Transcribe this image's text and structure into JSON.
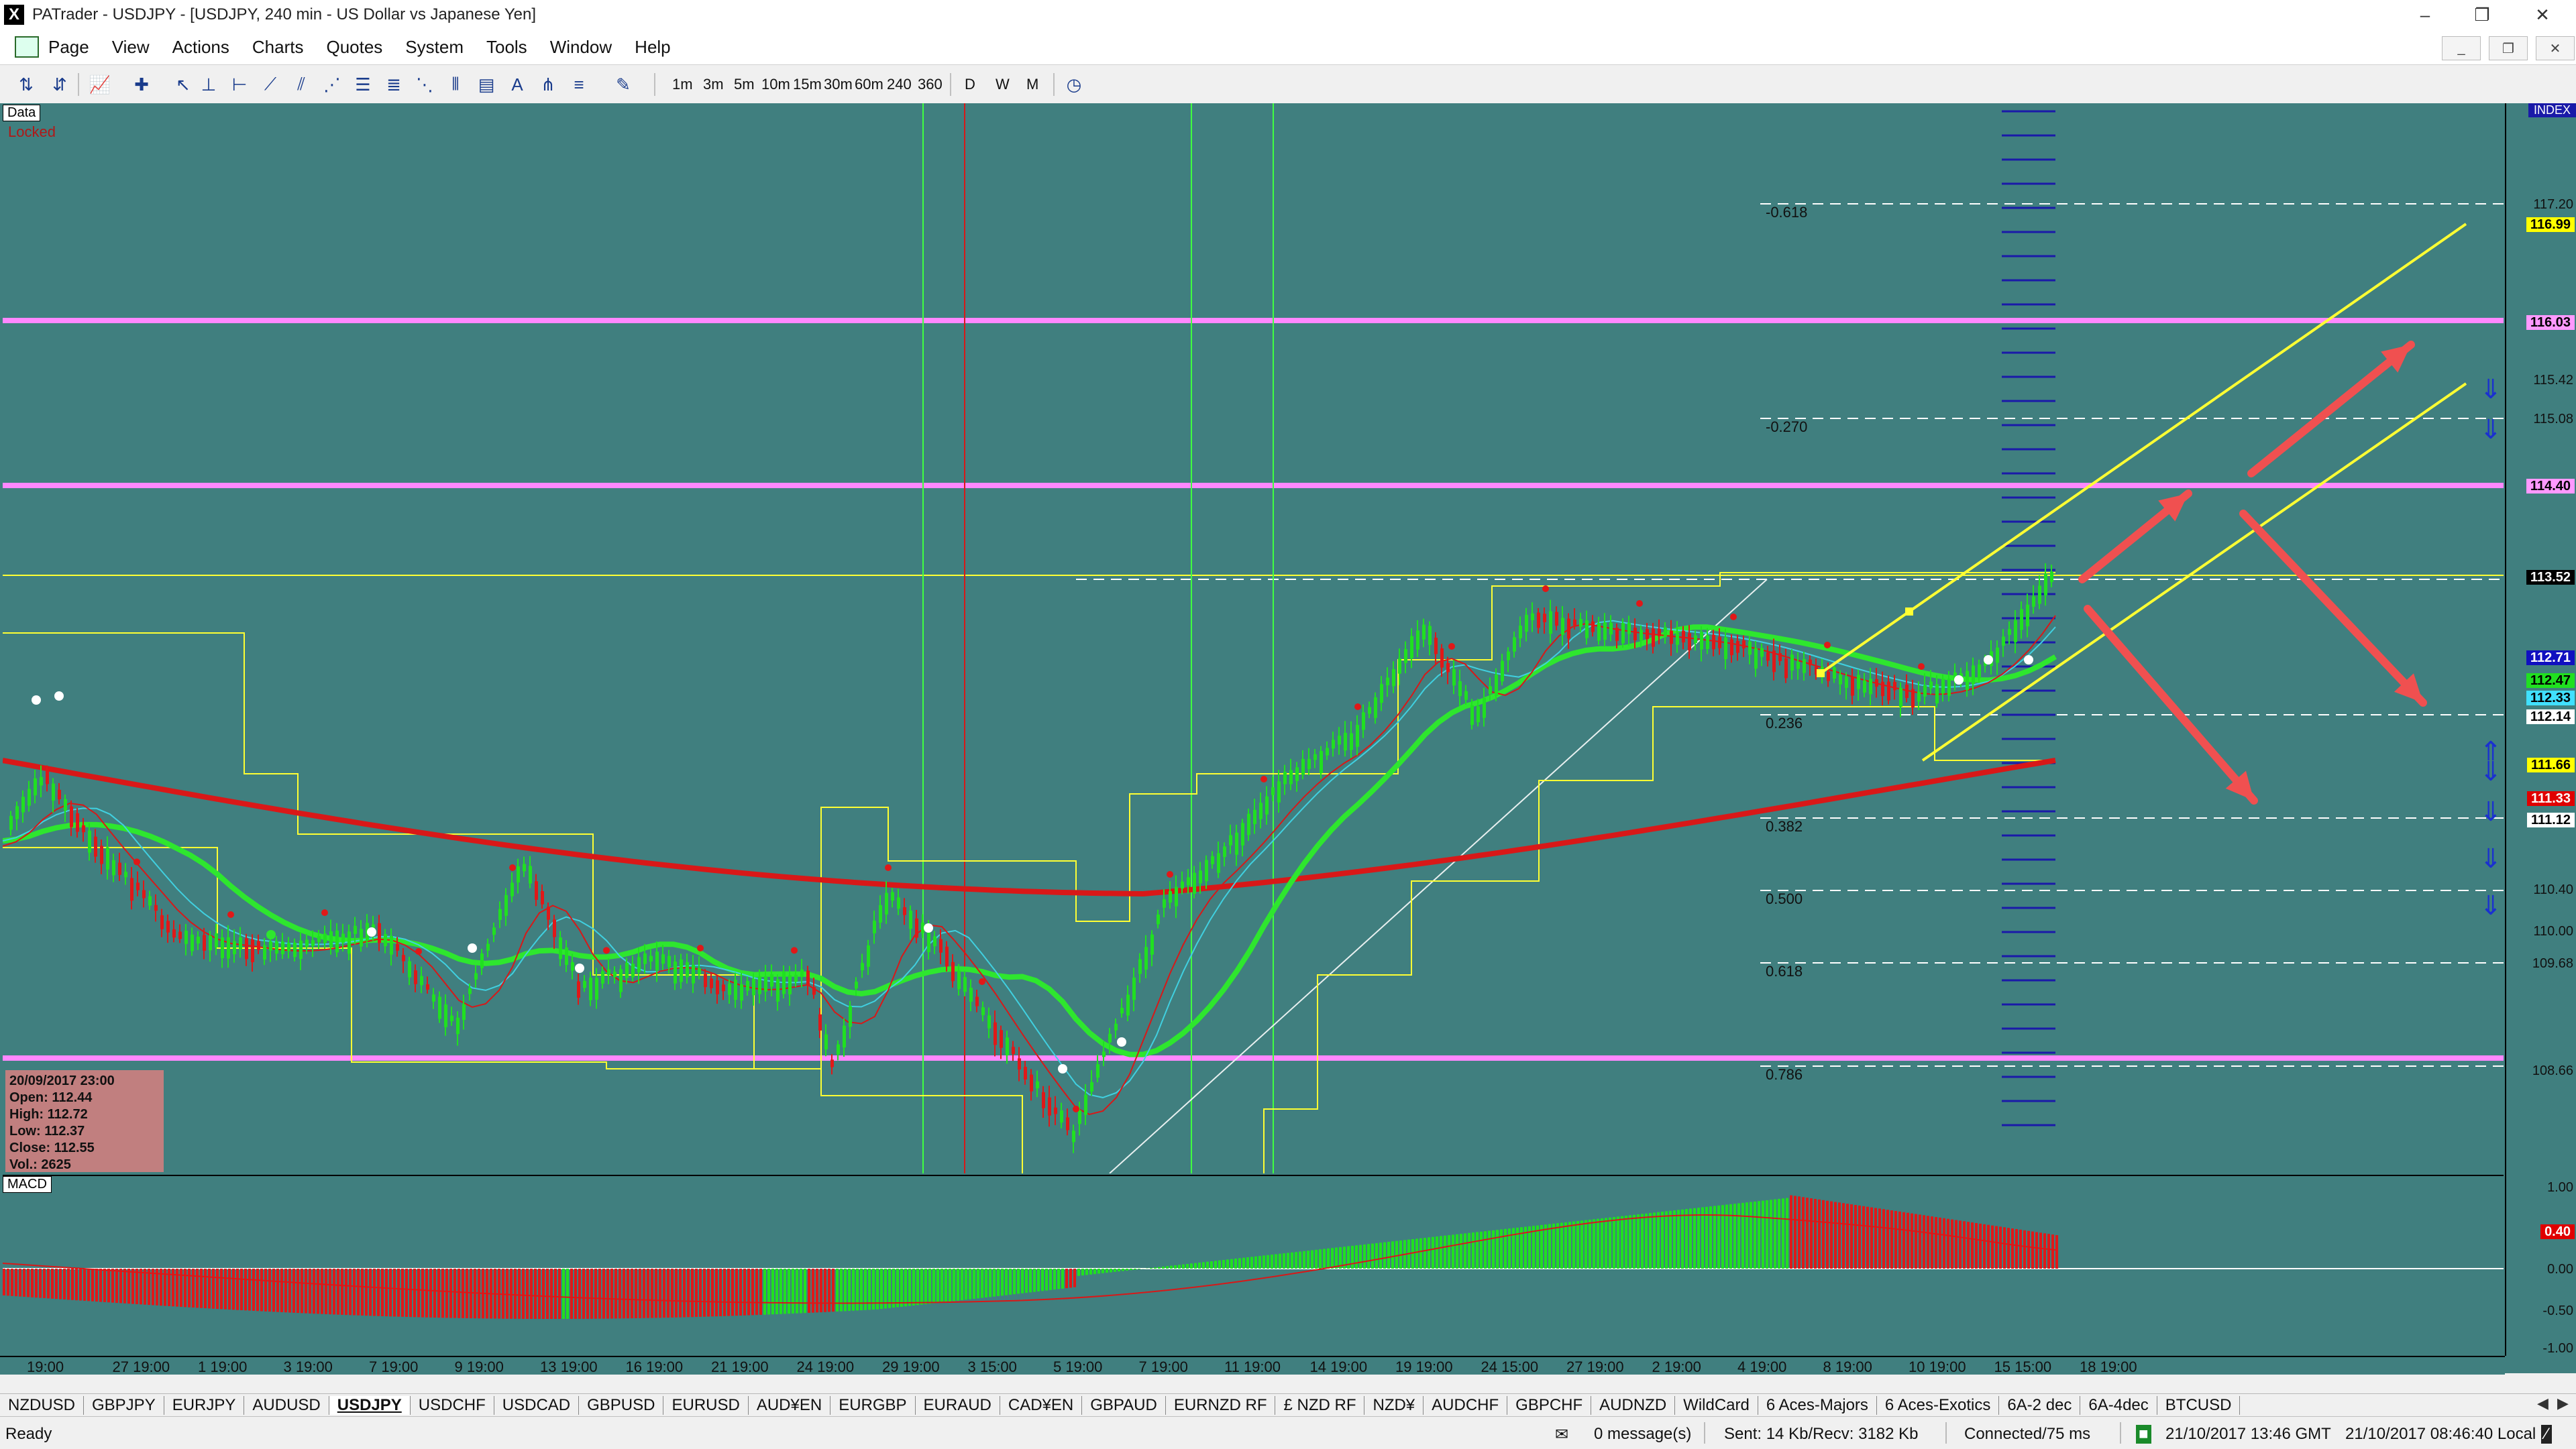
{
  "window": {
    "app_letter": "X",
    "title": "PATrader - USDJPY - [USDJPY, 240 min - US Dollar vs Japanese Yen]",
    "minimize": "–",
    "restore": "❐",
    "close": "✕"
  },
  "menu": {
    "items": [
      "Page",
      "View",
      "Actions",
      "Charts",
      "Quotes",
      "System",
      "Tools",
      "Window",
      "Help"
    ]
  },
  "toolbar": {
    "timeframes": [
      "1m",
      "3m",
      "5m",
      "10m",
      "15m",
      "30m",
      "60m",
      "240",
      "360"
    ],
    "periods": [
      "D",
      "W",
      "M"
    ]
  },
  "chart": {
    "data_tag": "Data",
    "locked_label": "Locked",
    "index_label": "INDEX",
    "macd_tag": "MACD",
    "ohlc": {
      "date": "20/09/2017 23:00",
      "open": "Open: 112.44",
      "high": "High: 112.72",
      "low": "Low: 112.37",
      "close": "Close: 112.55",
      "vol": "Vol.: 2625"
    },
    "fib_labels": [
      "-0.618",
      "-0.270",
      "0.236",
      "0.382",
      "0.500",
      "0.618",
      "0.786"
    ],
    "price_ticks": [
      "117.20",
      "115.42",
      "115.08",
      "110.40",
      "110.00",
      "109.68",
      "108.66"
    ],
    "price_labels": [
      {
        "text": "116.99",
        "bg": "#ffff00",
        "fg": "#000000"
      },
      {
        "text": "116.03",
        "bg": "#ff99ff",
        "fg": "#000000"
      },
      {
        "text": "114.40",
        "bg": "#ff99ff",
        "fg": "#000000"
      },
      {
        "text": "113.52",
        "bg": "#000000",
        "fg": "#ffffff"
      },
      {
        "text": "112.71",
        "bg": "#1010c0",
        "fg": "#ffffff"
      },
      {
        "text": "112.47",
        "bg": "#20e020",
        "fg": "#000000"
      },
      {
        "text": "112.33",
        "bg": "#40e0ff",
        "fg": "#000000"
      },
      {
        "text": "112.14",
        "bg": "#ffffff",
        "fg": "#000000"
      },
      {
        "text": "111.66",
        "bg": "#ffff00",
        "fg": "#000000"
      },
      {
        "text": "111.33",
        "bg": "#e00000",
        "fg": "#ffffff"
      },
      {
        "text": "111.12",
        "bg": "#ffffff",
        "fg": "#000000"
      }
    ],
    "macd_ticks": [
      "1.00",
      "0.50",
      "0.00",
      "-0.50",
      "-1.00"
    ],
    "macd_current": "0.40",
    "time_labels": [
      "19:00",
      "27 19:00",
      "1 19:00",
      "3 19:00",
      "7 19:00",
      "9 19:00",
      "13 19:00",
      "16 19:00",
      "21 19:00",
      "24 19:00",
      "29 19:00",
      "3 15:00",
      "5 19:00",
      "7 19:00",
      "11 19:00",
      "14 19:00",
      "19 19:00",
      "24 15:00",
      "27 19:00",
      "2 19:00",
      "4 19:00",
      "8 19:00",
      "10 19:00",
      "15 15:00",
      "18 19:00"
    ],
    "colors": {
      "background": "#407f7f",
      "bull": "#20e020",
      "bear": "#e01818",
      "ma_slow": "#d81818",
      "ma_mid": "#2ee62e",
      "ma_fast": "#40d0e0",
      "channel": "#ffff33",
      "horizontal_level": "#ff88ff",
      "arrow": "#f05050"
    }
  },
  "tabs": {
    "items": [
      "NZDUSD",
      "GBPJPY",
      "EURJPY",
      "AUDUSD",
      "USDJPY",
      "USDCHF",
      "USDCAD",
      "GBPUSD",
      "EURUSD",
      "AUD¥EN",
      "EURGBP",
      "EURAUD",
      "CAD¥EN",
      "GBPAUD",
      "EURNZD RF",
      "£ NZD RF",
      "NZD¥",
      "AUDCHF",
      "GBPCHF",
      "AUDNZD",
      "WildCard",
      "6 Aces-Majors",
      "6 Aces-Exotics",
      "6A-2 dec",
      "6A-4dec",
      "BTCUSD"
    ],
    "active": "USDJPY"
  },
  "status": {
    "ready": "Ready",
    "messages": "0 message(s)",
    "traffic": "Sent: 14 Kb/Recv: 3182 Kb",
    "connection": "Connected/75 ms",
    "gmt_time": "21/10/2017 13:46 GMT",
    "local_time": "21/10/2017 08:46:40 Local"
  }
}
